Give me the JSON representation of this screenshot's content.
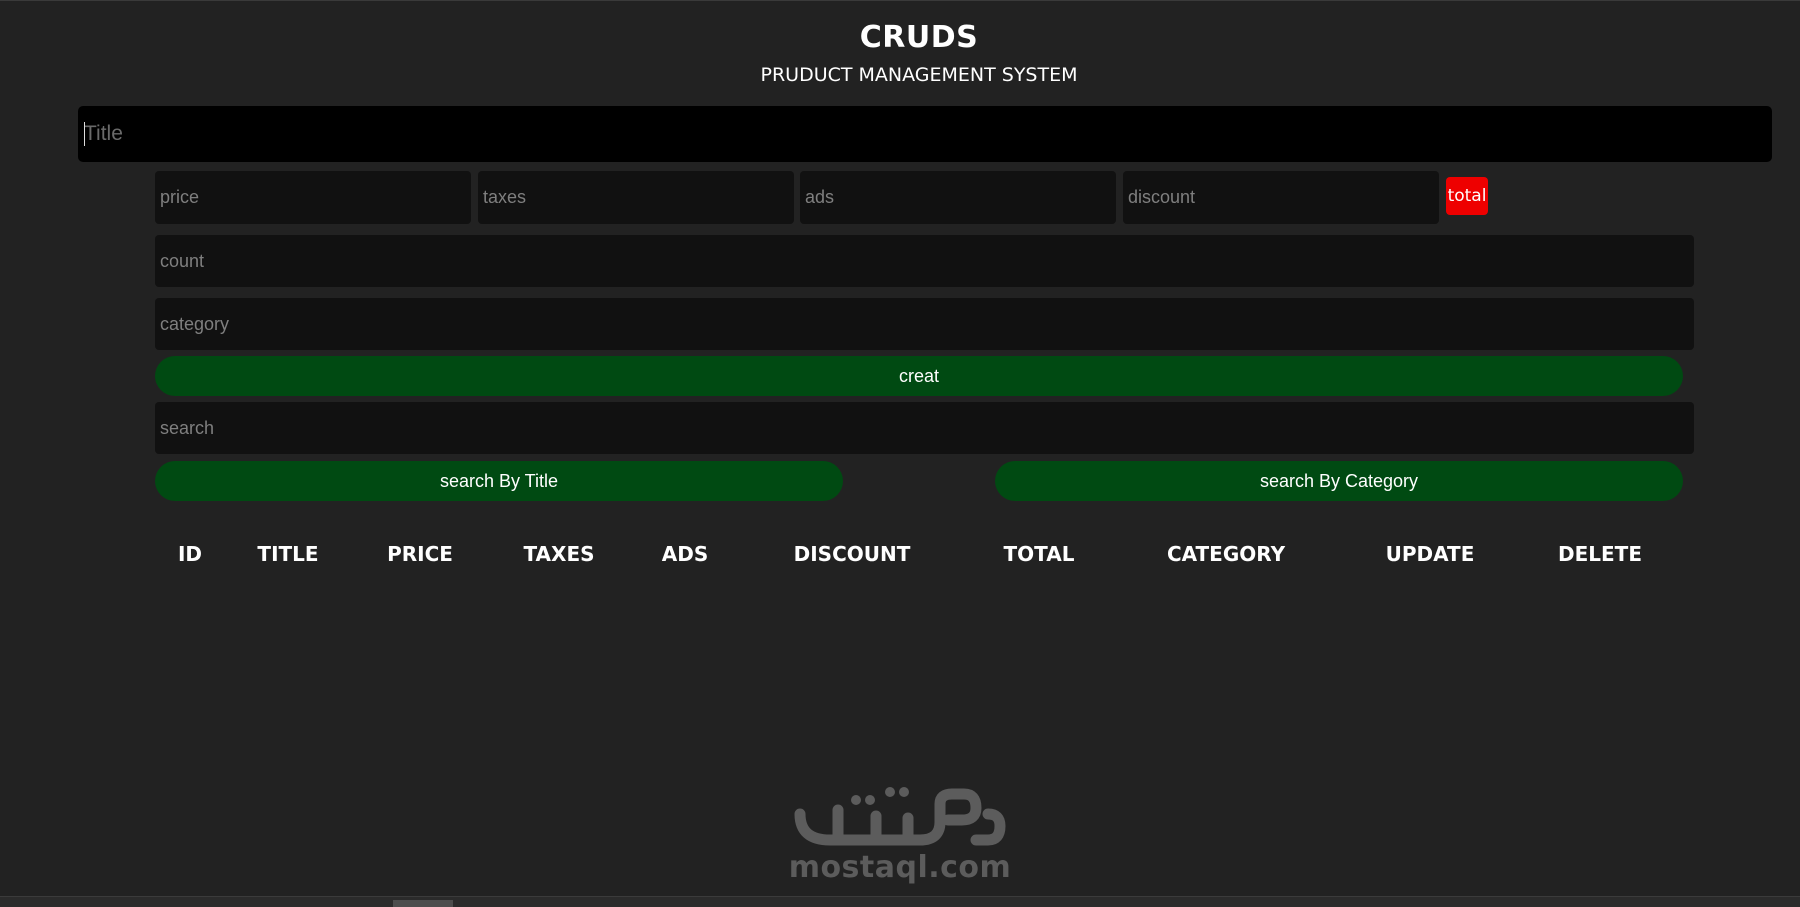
{
  "header": {
    "title": "CRUDS",
    "subtitle": "PRUDUCT MANAGEMENT SYSTEM"
  },
  "form": {
    "title_placeholder": "Title",
    "price_placeholder": "price",
    "taxes_placeholder": "taxes",
    "ads_placeholder": "ads",
    "discount_placeholder": "discount",
    "total_label": "total",
    "count_placeholder": "count",
    "category_placeholder": "category",
    "create_label": "creat"
  },
  "search": {
    "placeholder": "search",
    "by_title_label": "search By Title",
    "by_category_label": "search By Category"
  },
  "table": {
    "columns": [
      "ID",
      "TITLE",
      "PRICE",
      "TAXES",
      "ADS",
      "DISCOUNT",
      "TOTAL",
      "CATEGORY",
      "UPDATE",
      "DELETE"
    ],
    "rows": []
  },
  "watermark": {
    "text": "mostaql.com",
    "logo": "mostaql-arabic-wordmark"
  },
  "colors": {
    "background": "#222222",
    "input_background": "#111111",
    "title_input_background": "#000000",
    "button_green": "#004a12",
    "total_red": "#ee0000",
    "text": "#ffffff"
  }
}
